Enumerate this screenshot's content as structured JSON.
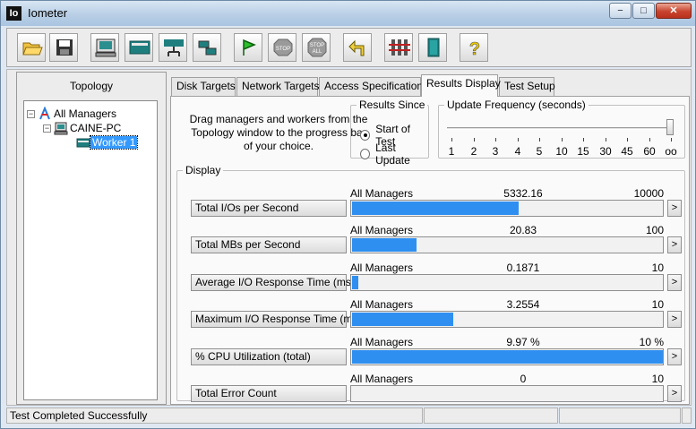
{
  "window": {
    "app_icon_text": "Io",
    "title": "Iometer",
    "controls": {
      "minimize": "−",
      "maximize": "□",
      "close": "✕"
    }
  },
  "toolbar": {
    "buttons": [
      "open-icon",
      "save-icon",
      "new-disk-worker-icon",
      "new-network-worker-icon",
      "duplicate-worker-icon",
      "disconnect-icon",
      "start-icon",
      "stop-icon",
      "stop-all-icon",
      "reset-workers-icon",
      "test-setup-icon",
      "exit-icon",
      "help-icon"
    ],
    "stop_label": "STOP",
    "stop_all_labels": [
      "STOP",
      "ALL"
    ],
    "help_label": "?"
  },
  "topology": {
    "title": "Topology",
    "nodes": [
      {
        "label": "All Managers",
        "expander": "−"
      },
      {
        "label": "CAINE-PC",
        "expander": "−"
      },
      {
        "label": "Worker 1"
      }
    ]
  },
  "tabs": [
    "Disk Targets",
    "Network Targets",
    "Access Specifications",
    "Results Display",
    "Test Setup"
  ],
  "active_tab": "Results Display",
  "results": {
    "instructions": "Drag managers and workers from the Topology window to the progress bar of your choice.",
    "results_since": {
      "legend": "Results Since",
      "options": [
        "Start of Test",
        "Last Update"
      ],
      "selected": "Start of Test"
    },
    "update_frequency": {
      "legend": "Update Frequency (seconds)",
      "ticks": [
        "1",
        "2",
        "3",
        "4",
        "5",
        "10",
        "15",
        "30",
        "45",
        "60",
        "oo"
      ],
      "selected": "oo"
    },
    "display_legend": "Display",
    "more_label": ">",
    "metrics": [
      {
        "button": "Total I/Os per Second",
        "source": "All Managers",
        "value": "5332.16",
        "max": "10000",
        "fill": 0.5332
      },
      {
        "button": "Total MBs per Second",
        "source": "All Managers",
        "value": "20.83",
        "max": "100",
        "fill": 0.2083
      },
      {
        "button": "Average I/O Response Time (ms)",
        "source": "All Managers",
        "value": "0.1871",
        "max": "10",
        "fill": 0.0187
      },
      {
        "button": "Maximum I/O Response Time (ms)",
        "source": "All Managers",
        "value": "3.2554",
        "max": "10",
        "fill": 0.3255
      },
      {
        "button": "% CPU Utilization (total)",
        "source": "All Managers",
        "value": "9.97 %",
        "max": "10 %",
        "fill": 0.997
      },
      {
        "button": "Total Error Count",
        "source": "All Managers",
        "value": "0",
        "max": "10",
        "fill": 0
      }
    ]
  },
  "statusbar": {
    "message": "Test Completed Successfully"
  },
  "colors": {
    "bar_fill": "#2f8ff0",
    "selection": "#3399ff"
  }
}
